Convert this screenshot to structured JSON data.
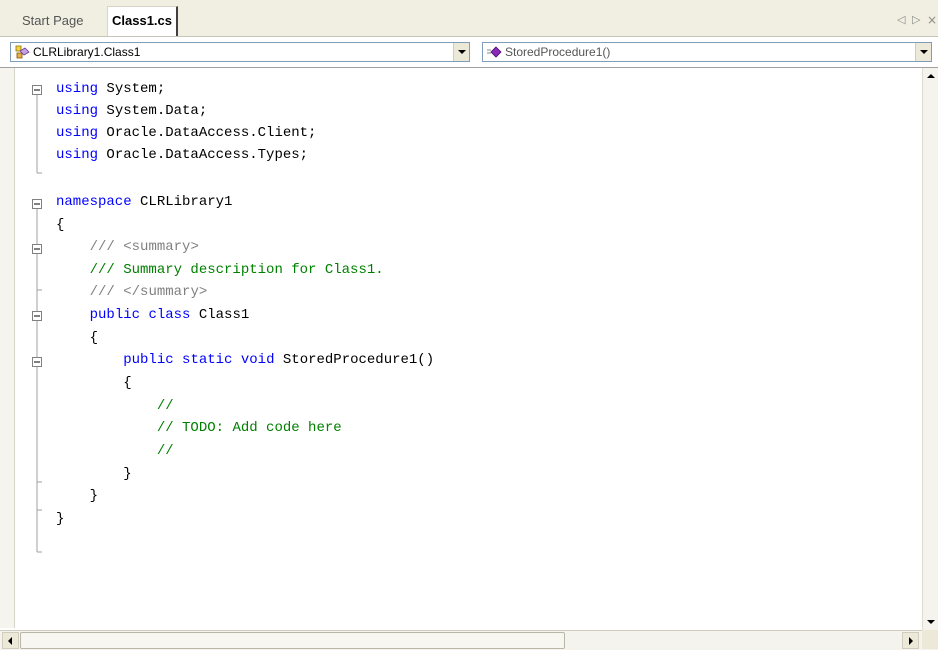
{
  "tabs": [
    {
      "label": "Start Page",
      "active": false
    },
    {
      "label": "Class1.cs",
      "active": true
    }
  ],
  "tab_controls": {
    "prev": "◁",
    "next": "▷",
    "close": "×"
  },
  "navigation": {
    "class_combo": {
      "value": "CLRLibrary1.Class1",
      "icon": "class-icon"
    },
    "member_combo": {
      "value": "StoredProcedure1()",
      "icon": "method-icon"
    }
  },
  "code_lines": [
    "using System;",
    "using System.Data;",
    "using Oracle.DataAccess.Client;",
    "using Oracle.DataAccess.Types;",
    "",
    "namespace CLRLibrary1",
    "{",
    "    /// <summary>",
    "    /// Summary description for Class1.",
    "    /// </summary>",
    "    public class Class1",
    "    {",
    "        public static void StoredProcedure1()",
    "        {",
    "            //",
    "            // TODO: Add code here",
    "            //",
    "        }",
    "    }",
    "}"
  ],
  "colors": {
    "keyword": "#0000ff",
    "comment": "#008000",
    "xml_doc_tag": "#808080",
    "text": "#000000"
  }
}
